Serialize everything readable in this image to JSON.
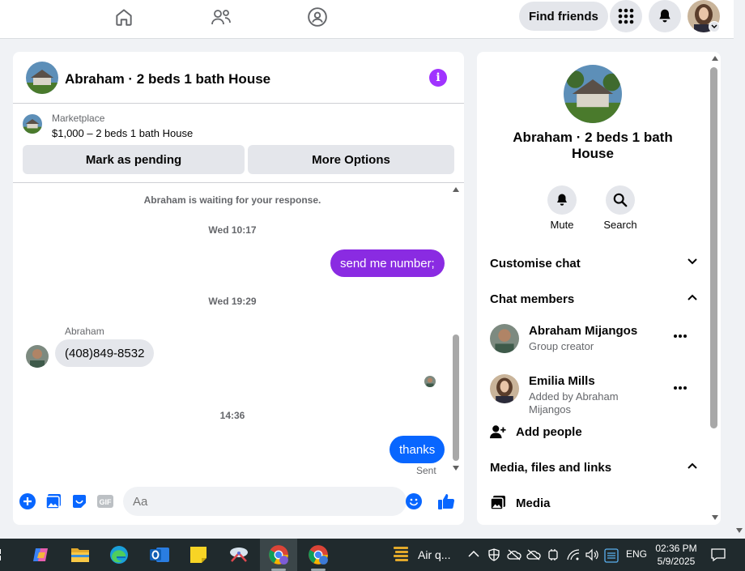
{
  "nav": {
    "find_friends_label": "Find friends"
  },
  "colors": {
    "accent_purple": "#8a2be2",
    "accent_blue": "#0866ff",
    "info_purple": "#a033ff"
  },
  "chat": {
    "title": "Abraham · 2 beds 1 bath House",
    "marketplace_label": "Marketplace",
    "listing": "$1,000 – 2 beds 1 bath House",
    "mark_pending_label": "Mark as pending",
    "more_options_label": "More Options",
    "waiting_text": "Abraham is waiting for your response.",
    "messages": [
      {
        "type": "time",
        "text": "Wed 10:17"
      },
      {
        "type": "out",
        "text": "send me number;"
      },
      {
        "type": "time",
        "text": "Wed 19:29"
      },
      {
        "type": "in",
        "sender": "Abraham",
        "text": "(408)849-8532"
      },
      {
        "type": "time",
        "text": "14:36"
      },
      {
        "type": "out",
        "text": "thanks",
        "status": "Sent"
      }
    ],
    "composer_placeholder": "Aa"
  },
  "info": {
    "title": "Abraham · 2 beds 1 bath House",
    "mute_label": "Mute",
    "search_label": "Search",
    "customise_label": "Customise chat",
    "members_label": "Chat members",
    "members": [
      {
        "name": "Abraham Mijangos",
        "subtitle": "Group creator"
      },
      {
        "name": "Emilia Mills",
        "subtitle": "Added by Abraham Mijangos"
      }
    ],
    "add_people_label": "Add people",
    "media_section_label": "Media, files and links",
    "media_label": "Media"
  },
  "taskbar": {
    "weather_label": "Air q...",
    "lang": "ENG",
    "time": "02:36 PM",
    "date": "5/9/2025"
  }
}
